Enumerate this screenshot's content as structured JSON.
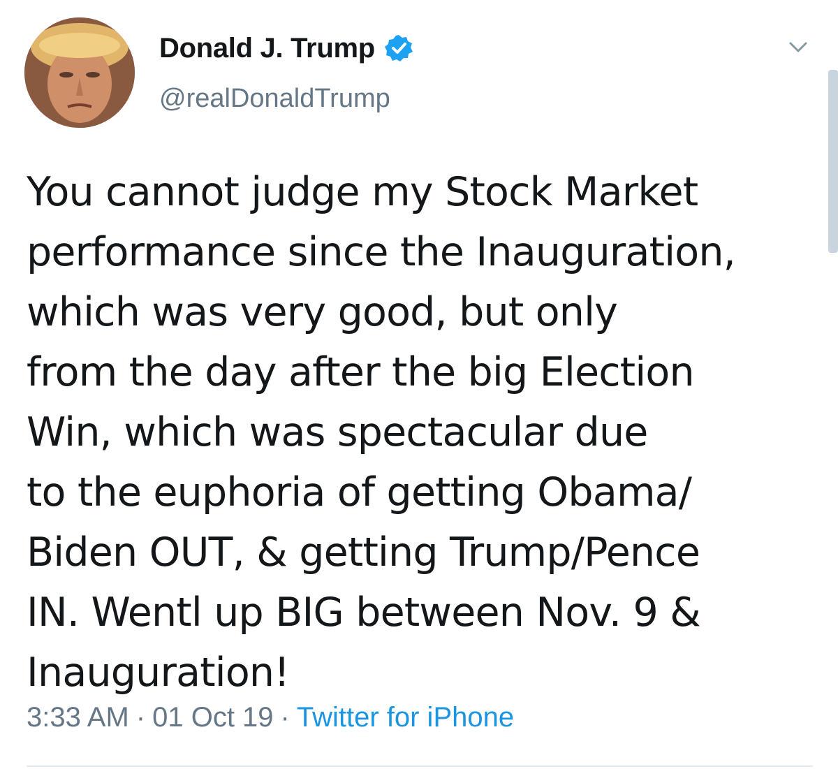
{
  "tweet": {
    "author": {
      "display_name": "Donald J. Trump",
      "handle": "@realDonaldTrump",
      "verified": true
    },
    "text_lines": [
      "You cannot judge my Stock Market",
      "performance since the Inauguration,",
      "which was very good, but only",
      "from the day after the big Election",
      "Win, which was spectacular due",
      "to the euphoria of getting Obama/",
      "Biden OUT, & getting Trump/Pence",
      "IN. Wentl up BIG between Nov. 9 &",
      "Inauguration!"
    ],
    "time": "3:33 AM",
    "date": "01 Oct 19",
    "separator": "·",
    "source": "Twitter for iPhone"
  },
  "icons": {
    "verified": "verified-badge-icon",
    "menu": "chevron-down-icon",
    "avatar": "profile-photo"
  },
  "colors": {
    "text_primary": "#14171a",
    "text_secondary": "#657786",
    "link": "#1b95e0",
    "verified_badge": "#1da1f2",
    "divider": "#e1e8ed"
  }
}
